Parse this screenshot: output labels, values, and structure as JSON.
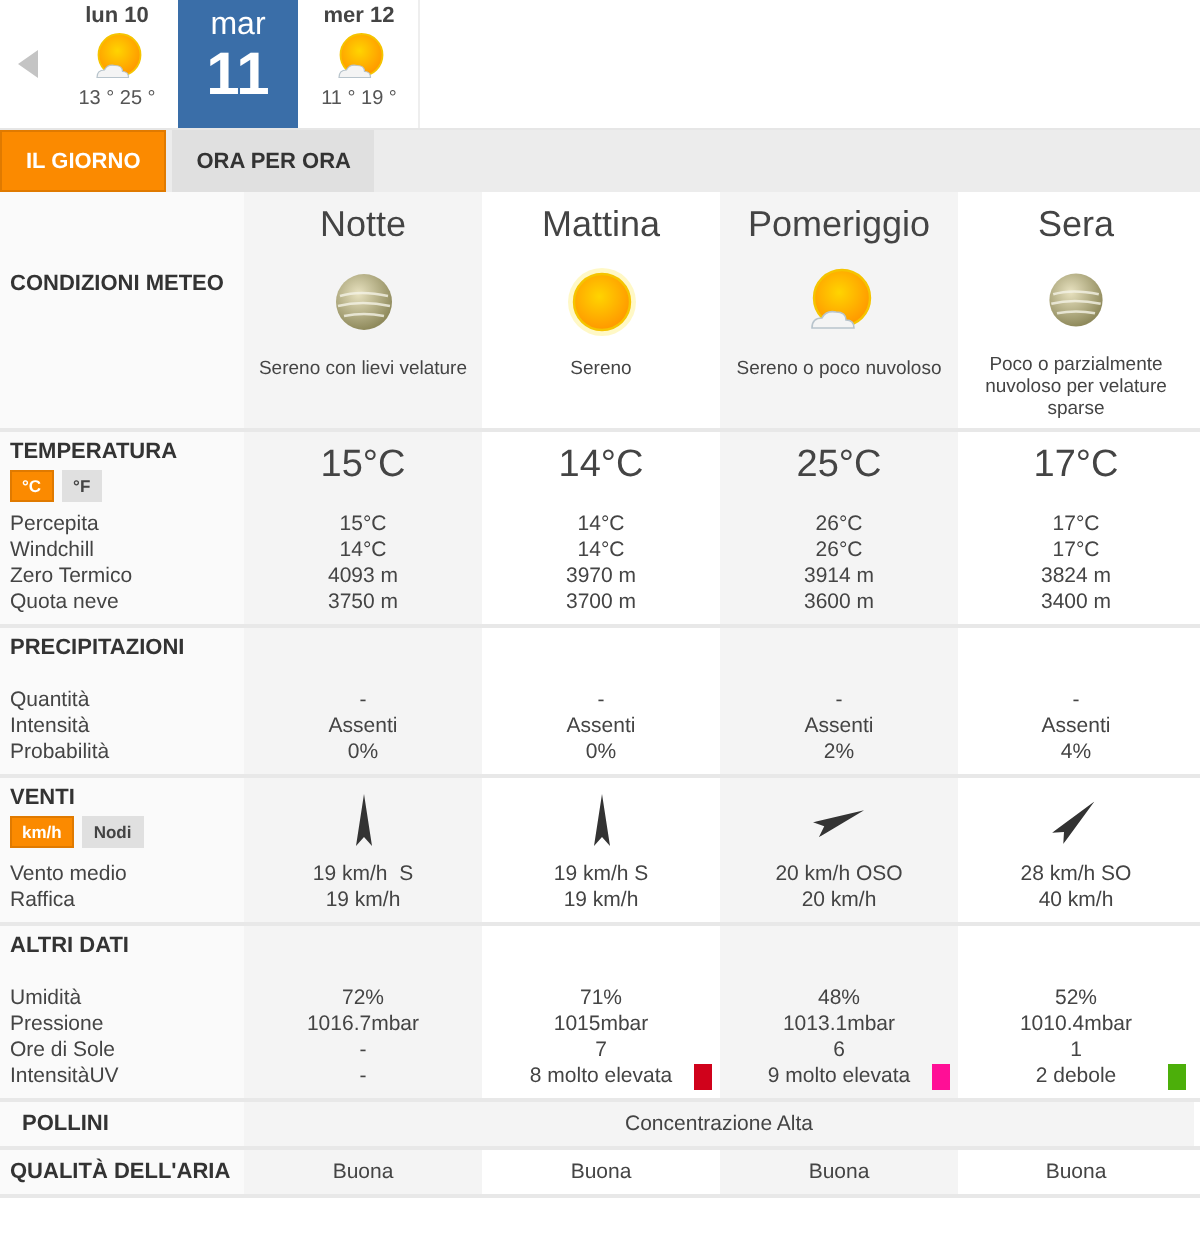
{
  "day_strip": {
    "days": [
      {
        "day": "lun 10",
        "kind": "sun-cloud",
        "temps": "13 ° 25 °",
        "selected": false
      },
      {
        "day": "mar",
        "number": "11",
        "selected": true
      },
      {
        "day": "mer 12",
        "kind": "sun-cloud",
        "temps": "11 ° 19 °",
        "selected": false
      }
    ]
  },
  "tabs": [
    {
      "label": "IL GIORNO",
      "selected": true
    },
    {
      "label": "ORA PER ORA",
      "selected": false
    }
  ],
  "conditions_title": "CONDIZIONI METEO",
  "periods": [
    {
      "name": "Notte",
      "kind": "veiled",
      "description": "Sereno con lievi velature"
    },
    {
      "name": "Mattina",
      "kind": "sun",
      "description": "Sereno"
    },
    {
      "name": "Pomeriggio",
      "kind": "sun-cloud",
      "description": "Sereno o poco nuvoloso"
    },
    {
      "name": "Sera",
      "kind": "veiled",
      "description": "Poco o parzialmente nuvoloso per velature sparse"
    }
  ],
  "sections": [
    {
      "kind": "temperature",
      "title": "TEMPERATURA",
      "units": [
        {
          "label": "°C",
          "selected": true
        },
        {
          "label": "°F",
          "selected": false
        }
      ],
      "headline": [
        "15°C",
        "14°C",
        "25°C",
        "17°C"
      ],
      "rows": [
        {
          "label": "Percepita",
          "values": [
            "15°C",
            "14°C",
            "26°C",
            "17°C"
          ]
        },
        {
          "label": "Windchill",
          "values": [
            "14°C",
            "14°C",
            "26°C",
            "17°C"
          ]
        },
        {
          "label": "Zero Termico",
          "values": [
            "4093 m",
            "3970 m",
            "3914 m",
            "3824 m"
          ]
        },
        {
          "label": "Quota neve",
          "values": [
            "3750 m",
            "3700 m",
            "3600 m",
            "3400 m"
          ]
        }
      ]
    },
    {
      "kind": "plain",
      "title": "PRECIPITAZIONI",
      "rows": [
        {
          "label": "Quantità",
          "values": [
            "-",
            "-",
            "-",
            "-"
          ]
        },
        {
          "label": "Intensità",
          "values": [
            "Assenti",
            "Assenti",
            "Assenti",
            "Assenti"
          ]
        },
        {
          "label": "Probabilità",
          "values": [
            "0%",
            "0%",
            "2%",
            "4%"
          ]
        }
      ]
    },
    {
      "kind": "wind",
      "title": "VENTI",
      "units": [
        {
          "label": "km/h",
          "selected": true
        },
        {
          "label": "Nodi",
          "selected": false
        }
      ],
      "arrows": [
        {
          "kind": "north"
        },
        {
          "kind": "north"
        },
        {
          "kind": "east-north-east"
        },
        {
          "kind": "north-east"
        }
      ],
      "rows": [
        {
          "label": "Vento medio",
          "values": [
            "19 km/h  S",
            "19 km/h S",
            "20 km/h OSO",
            "28 km/h SO"
          ]
        },
        {
          "label": "Raffica",
          "values": [
            "19 km/h",
            "19 km/h",
            "20 km/h",
            "40 km/h"
          ]
        }
      ]
    },
    {
      "kind": "plain",
      "title": "ALTRI DATI",
      "rows": [
        {
          "label": "Umidità",
          "values": [
            "72%",
            "71%",
            "48%",
            "52%"
          ]
        },
        {
          "label": "Pressione",
          "values": [
            "1016.7mbar",
            "1015mbar",
            "1013.1mbar",
            "1010.4mbar"
          ]
        },
        {
          "label": "Ore di Sole",
          "values": [
            "-",
            "7",
            "6",
            "1"
          ]
        },
        {
          "label": "IntensitàUV",
          "values": [
            {
              "text": "-"
            },
            {
              "text": "8 molto elevata",
              "color": "#d0021b"
            },
            {
              "text": "9 molto elevata",
              "color": "#ff0f96"
            },
            {
              "text": "2 debole",
              "color": "#4caf0a"
            }
          ]
        }
      ]
    }
  ],
  "pollen": {
    "title": "POLLINI",
    "value": "Concentrazione Alta"
  },
  "air_quality": {
    "title": "QUALITÀ DELL'ARIA",
    "values": [
      "Buona",
      "Buona",
      "Buona",
      "Buona"
    ]
  }
}
